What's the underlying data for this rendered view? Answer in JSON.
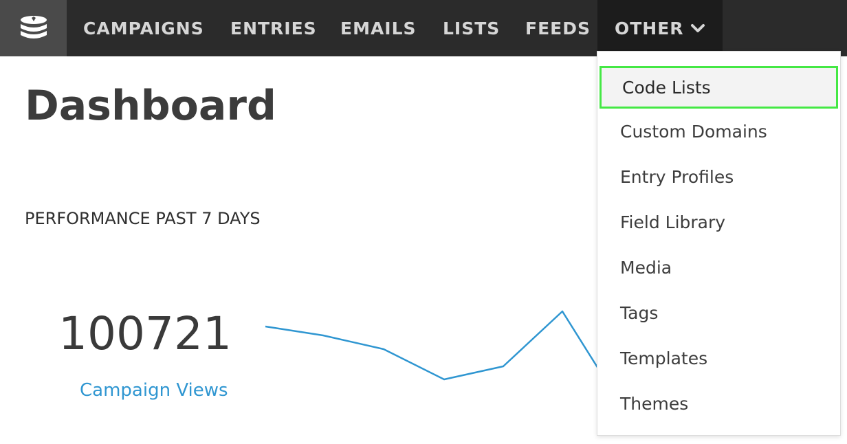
{
  "nav": {
    "logo_icon": "database-stack-icon",
    "items": [
      {
        "label": "CAMPAIGNS"
      },
      {
        "label": "ENTRIES"
      },
      {
        "label": "EMAILS"
      },
      {
        "label": "LISTS"
      },
      {
        "label": "FEEDS"
      }
    ],
    "other": {
      "label": "OTHER",
      "icon": "chevron-down-icon"
    }
  },
  "page": {
    "title": "Dashboard",
    "section_label": "PERFORMANCE PAST 7 DAYS"
  },
  "metric": {
    "value": "100721",
    "label": "Campaign Views",
    "label_color": "#2f96d1"
  },
  "dropdown": {
    "items": [
      {
        "label": "Code Lists",
        "active": true
      },
      {
        "label": "Custom Domains"
      },
      {
        "label": "Entry Profiles"
      },
      {
        "label": "Field Library"
      },
      {
        "label": "Media"
      },
      {
        "label": "Tags"
      },
      {
        "label": "Templates"
      },
      {
        "label": "Themes"
      }
    ],
    "highlight_color": "#44e844"
  },
  "colors": {
    "topbar": "#2b2b2b",
    "accent": "#2f96d1"
  }
}
